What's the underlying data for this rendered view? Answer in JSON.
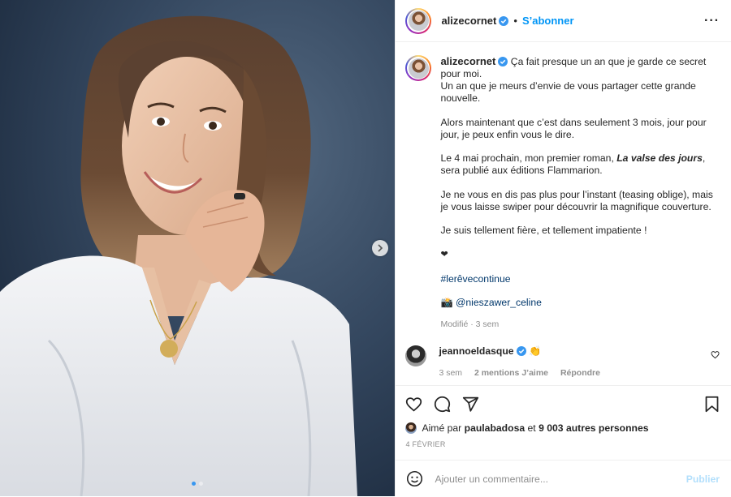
{
  "post": {
    "username": "alizecornet",
    "follow_label": "S’abonner",
    "separator": "•",
    "more_label": "···",
    "caption": {
      "username": "alizecornet",
      "line1": "Ça fait presque un an que je garde ce secret pour moi.",
      "line2": "Un an que je meurs d’envie de vous partager cette grande nouvelle.",
      "para2": "Alors maintenant que c’est dans seulement 3 mois, jour pour jour, je peux enfin vous le dire.",
      "para3_before": "Le 4 mai prochain, mon premier roman, ",
      "para3_title": "La valse des jours",
      "para3_after": ", sera publié aux éditions Flammarion.",
      "para4": "Je ne vous en dis pas plus pour l’instant (teasing oblige), mais je vous laisse swiper pour découvrir la magnifique couverture.",
      "para5": "Je suis tellement fière, et tellement impatiente !",
      "heart": "❤",
      "hashtag": "#lerêvecontinue",
      "camera_emoji": "📸",
      "credit": "@nieszawer_celine",
      "edited": "Modifié",
      "edited_time": "3 sem"
    },
    "comment": {
      "username": "jeannoeldasque",
      "text": "👏",
      "time": "3 sem",
      "likes": "2 mentions J’aime",
      "reply": "Répondre"
    },
    "likes": {
      "prefix": "Aimé par",
      "user": "paulabadosa",
      "connector": "et",
      "others": "9 003 autres personnes"
    },
    "date": "4 FÉVRIER",
    "add_comment_placeholder": "Ajouter un commentaire...",
    "publish_label": "Publier",
    "carousel": {
      "slide_count": 2,
      "active_index": 0
    }
  },
  "colors": {
    "link_blue": "#0095f6",
    "hashtag_blue": "#00376b",
    "muted": "#8e8e8e",
    "publish_disabled": "#b2dffc",
    "verified": "#3897f0"
  },
  "icons": [
    "verified-badge-icon",
    "more-options-icon",
    "chevron-right-icon",
    "heart-icon",
    "comment-icon",
    "share-icon",
    "bookmark-icon",
    "emoji-icon"
  ]
}
